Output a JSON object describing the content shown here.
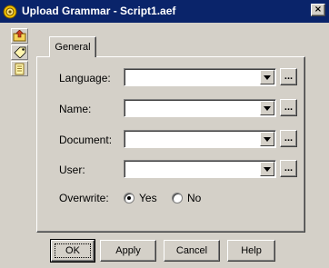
{
  "window": {
    "title": "Upload Grammar - Script1.aef",
    "title_icon": "app-gear-icon",
    "close_label": "×",
    "titlebar_color": "#0a246a"
  },
  "toolstrip": [
    {
      "icon": "upload-icon"
    },
    {
      "icon": "tag-icon"
    },
    {
      "icon": "document-icon"
    }
  ],
  "tabs": [
    {
      "label": "General",
      "selected": true
    }
  ],
  "form": {
    "fields": [
      {
        "label": "Language:",
        "value": "",
        "browse_label": "..."
      },
      {
        "label": "Name:",
        "value": "",
        "browse_label": "..."
      },
      {
        "label": "Document:",
        "value": "",
        "browse_label": "..."
      },
      {
        "label": "User:",
        "value": "",
        "browse_label": "..."
      }
    ],
    "overwrite": {
      "label": "Overwrite:",
      "options": [
        {
          "label": "Yes",
          "selected": true
        },
        {
          "label": "No",
          "selected": false
        }
      ]
    }
  },
  "buttons": {
    "ok": "OK",
    "apply": "Apply",
    "cancel": "Cancel",
    "help": "Help"
  }
}
